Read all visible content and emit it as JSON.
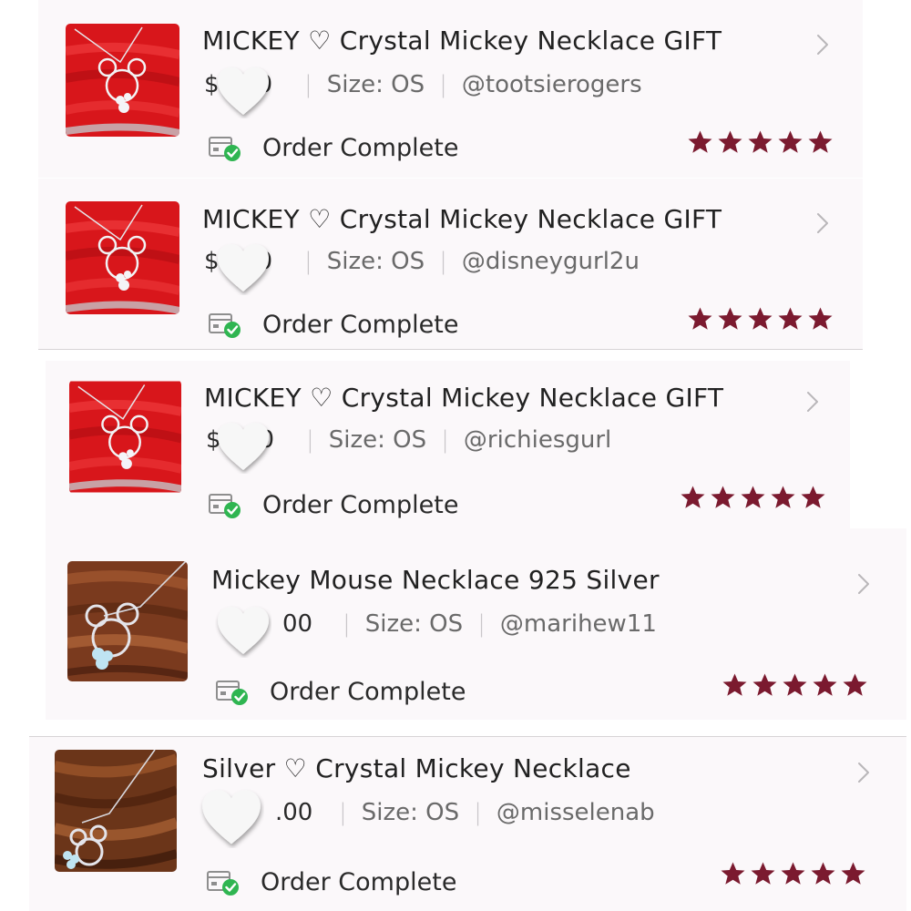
{
  "colors": {
    "star": "#7b1a2f",
    "text_primary": "#212121",
    "text_secondary": "#6a6a6a",
    "check_green": "#2fb551",
    "card_bg": "#fbf8fa"
  },
  "orders": [
    {
      "title": "MICKEY ♡ Crystal Mickey Necklace GIFT",
      "price_visible": "$",
      "price_suffix": "0",
      "size": "Size: OS",
      "seller": "@tootsierogers",
      "status": "Order Complete",
      "rating": 5,
      "thumbnail": "red-necklace-photo",
      "status_icon": "package-check-icon",
      "chevron_icon": "chevron-right-icon",
      "overlay_icon": "white-heart-icon"
    },
    {
      "title": "MICKEY ♡ Crystal Mickey Necklace GIFT",
      "price_visible": "$",
      "price_suffix": "0",
      "size": "Size: OS",
      "seller": "@disneygurl2u",
      "status": "Order Complete",
      "rating": 5,
      "thumbnail": "red-necklace-photo",
      "status_icon": "package-check-icon",
      "chevron_icon": "chevron-right-icon",
      "overlay_icon": "white-heart-icon"
    },
    {
      "title": "MICKEY ♡ Crystal Mickey Necklace GIFT",
      "price_visible": "$",
      "price_suffix": "0",
      "size": "Size: OS",
      "seller": "@richiesgurl",
      "status": "Order Complete",
      "rating": 5,
      "thumbnail": "red-necklace-photo",
      "status_icon": "package-check-icon",
      "chevron_icon": "chevron-right-icon",
      "overlay_icon": "white-heart-icon"
    },
    {
      "title": "Mickey Mouse Necklace 925 Silver",
      "price_visible": "",
      "price_suffix": "00",
      "size": "Size: OS",
      "seller": "@marihew11",
      "status": "Order Complete",
      "rating": 5,
      "thumbnail": "wood-necklace-photo",
      "status_icon": "package-check-icon",
      "chevron_icon": "chevron-right-icon",
      "overlay_icon": "white-heart-icon"
    },
    {
      "title": "Silver ♡ Crystal Mickey Necklace",
      "price_visible": "",
      "price_suffix": ".00",
      "size": "Size: OS",
      "seller": "@misselenab",
      "status": "Order Complete",
      "rating": 5,
      "thumbnail": "wood-necklace-photo",
      "status_icon": "package-check-icon",
      "chevron_icon": "chevron-right-icon",
      "overlay_icon": "white-heart-icon"
    }
  ]
}
